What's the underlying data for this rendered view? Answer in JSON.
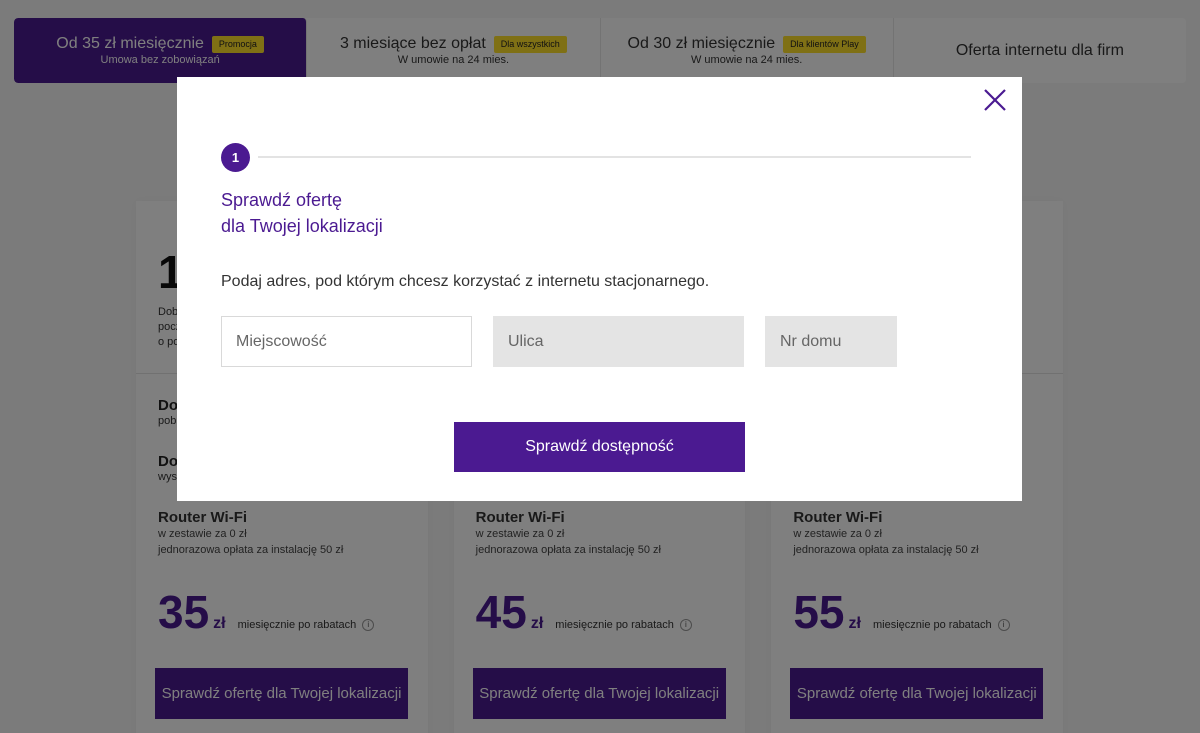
{
  "tabs": [
    {
      "title": "Od 35 zł miesięcznie",
      "sub": "Umowa bez zobowiązań",
      "badge": "Promocja"
    },
    {
      "title": "3 miesiące bez opłat",
      "sub": "W umowie na 24 mies.",
      "badge": "Dla wszystkich"
    },
    {
      "title": "Od 30 zł miesięcznie",
      "sub": "W umowie na 24 mies.",
      "badge": "Dla klientów Play"
    },
    {
      "title": "Oferta internetu dla firm"
    }
  ],
  "cards": [
    {
      "speed_partial": "1",
      "desc_partial": "Dob\npocz\no po",
      "feat1_partial": "Do",
      "feat1_sub_partial": "pob",
      "feat2_partial": "Do",
      "feat2_sub_partial": "wys",
      "router_title": "Router Wi-Fi",
      "router_line1": "w zestawie za 0 zł",
      "router_line2": "jednorazowa opłata za instalację 50 zł",
      "price": "35",
      "currency": "zł",
      "price_note": "miesięcznie po rabatach",
      "info_icon": "i",
      "button": "Sprawdź ofertę dla Twojej lokalizacji"
    },
    {
      "router_title": "Router Wi-Fi",
      "router_line1": "w zestawie za 0 zł",
      "router_line2": "jednorazowa opłata za instalację 50 zł",
      "price": "45",
      "currency": "zł",
      "price_note": "miesięcznie po rabatach",
      "info_icon": "i",
      "button": "Sprawdź ofertę dla Twojej lokalizacji"
    },
    {
      "router_title": "Router Wi-Fi",
      "router_line1": "w zestawie za 0 zł",
      "router_line2": "jednorazowa opłata za instalację 50 zł",
      "price": "55",
      "currency": "zł",
      "price_note": "miesięcznie po rabatach",
      "info_icon": "i",
      "button": "Sprawdź ofertę dla Twojej lokalizacji"
    }
  ],
  "modal": {
    "step_number": "1",
    "title_line1": "Sprawdź ofertę",
    "title_line2": "dla Twojej lokalizacji",
    "description": "Podaj adres, pod którym chcesz korzystać z internetu stacjonarnego.",
    "city_placeholder": "Miejscowość",
    "city_value": "",
    "street_placeholder": "Ulica",
    "street_value": "",
    "house_placeholder": "Nr domu",
    "house_value": "",
    "submit_label": "Sprawdź dostępność",
    "close_icon": "close-icon"
  },
  "colors": {
    "brand": "#4b1a91",
    "badge": "#ffe12b",
    "overlay": "rgba(0,0,0,0.5)"
  }
}
